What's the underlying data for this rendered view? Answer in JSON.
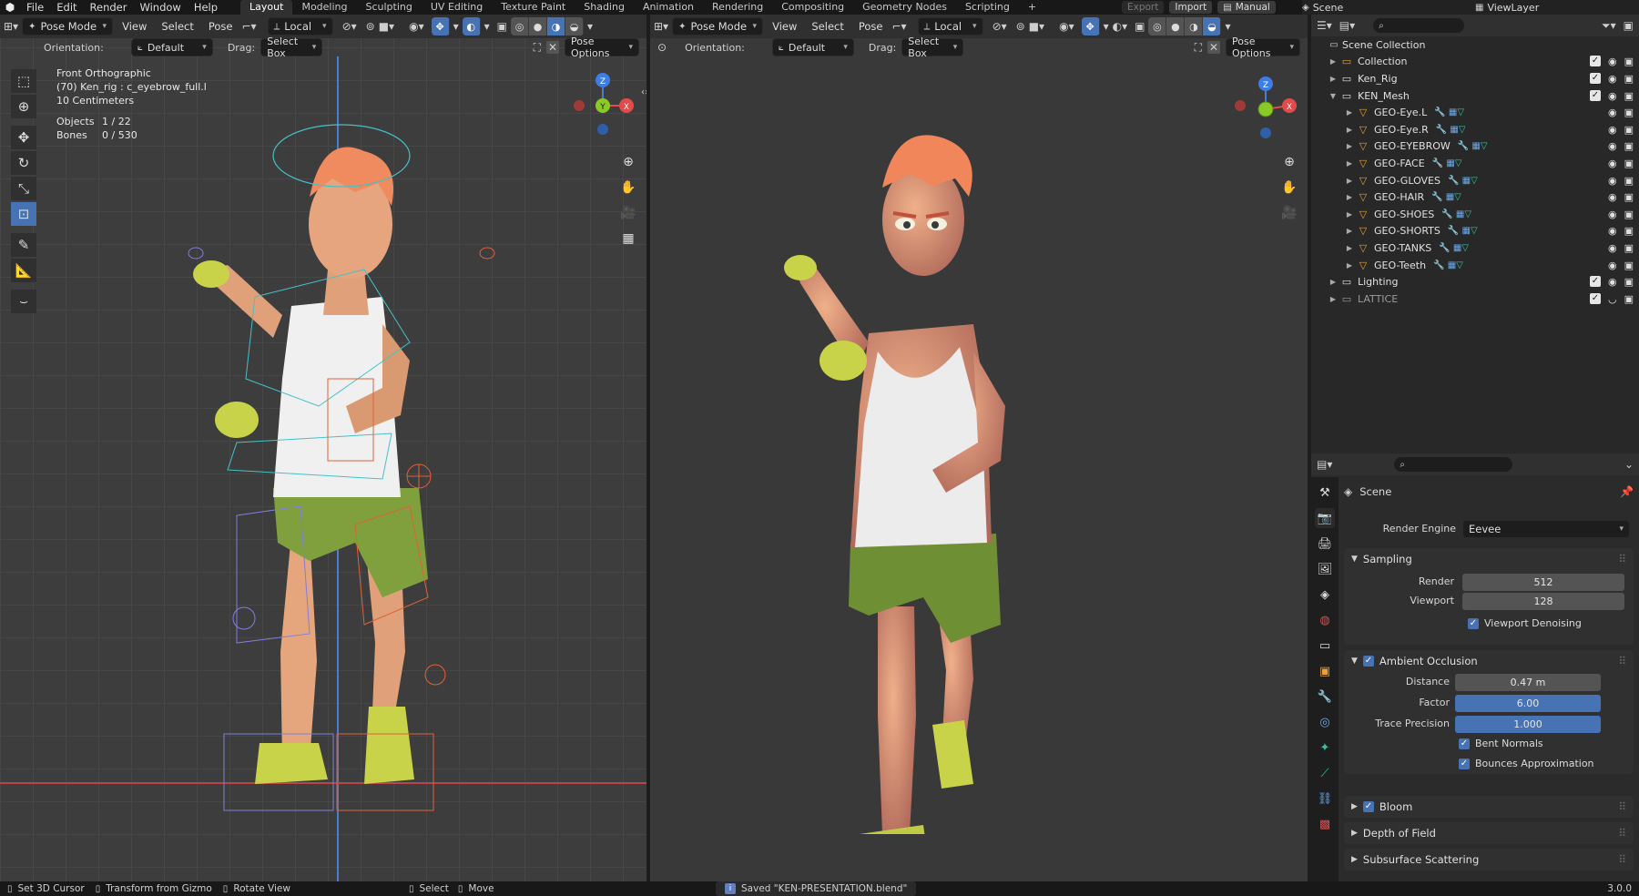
{
  "topbar": {
    "menus": [
      "File",
      "Edit",
      "Render",
      "Window",
      "Help"
    ],
    "workspaces": [
      {
        "label": "Layout",
        "active": true
      },
      {
        "label": "Modeling",
        "active": false
      },
      {
        "label": "Sculpting",
        "active": false
      },
      {
        "label": "UV Editing",
        "active": false
      },
      {
        "label": "Texture Paint",
        "active": false
      },
      {
        "label": "Shading",
        "active": false
      },
      {
        "label": "Animation",
        "active": false
      },
      {
        "label": "Rendering",
        "active": false
      },
      {
        "label": "Compositing",
        "active": false
      },
      {
        "label": "Geometry Nodes",
        "active": false
      },
      {
        "label": "Scripting",
        "active": false
      }
    ],
    "add_tab": "+",
    "export_label": "Export",
    "import_label": "Import",
    "manual_label": "Manual",
    "scene_label": "Scene",
    "viewlayer_label": "ViewLayer"
  },
  "left_viewport": {
    "mode": "Pose Mode",
    "menus": [
      "View",
      "Select",
      "Pose"
    ],
    "transform_orientation": "Local",
    "orientation_label": "Orientation:",
    "orientation_value": "Default",
    "drag_label": "Drag:",
    "drag_value": "Select Box",
    "pose_options": "Pose Options",
    "overlay": {
      "view_name": "Front Orthographic",
      "active": "(70) Ken_rig : c_eyebrow_full.l",
      "scale": "10 Centimeters",
      "objects_label": "Objects",
      "objects_value": "1 / 22",
      "bones_label": "Bones",
      "bones_value": "0 / 530"
    },
    "gizmo": {
      "z": "Z",
      "y": "Y",
      "x": "X"
    }
  },
  "right_viewport": {
    "mode": "Pose Mode",
    "menus": [
      "View",
      "Select",
      "Pose"
    ],
    "transform_orientation": "Local",
    "orientation_label": "Orientation:",
    "orientation_value": "Default",
    "drag_label": "Drag:",
    "drag_value": "Select Box",
    "pose_options": "Pose Options",
    "gizmo": {
      "z": "Z",
      "x": "X"
    }
  },
  "outliner": {
    "root": "Scene Collection",
    "items": [
      {
        "label": "Collection",
        "depth": 1,
        "expanded": false,
        "icon_color": "#e8a03c",
        "muted": false
      },
      {
        "label": "Ken_Rig",
        "depth": 1,
        "expanded": false,
        "icon_color": "#e0e0e0",
        "muted": false
      },
      {
        "label": "KEN_Mesh",
        "depth": 1,
        "expanded": true,
        "icon_color": "#e0e0e0",
        "muted": false
      },
      {
        "label": "GEO-Eye.L",
        "depth": 2,
        "expanded": false,
        "icon_color": "#e8a03c",
        "muted": false
      },
      {
        "label": "GEO-Eye.R",
        "depth": 2,
        "expanded": false,
        "icon_color": "#e8a03c",
        "muted": false
      },
      {
        "label": "GEO-EYEBROW",
        "depth": 2,
        "expanded": false,
        "icon_color": "#e8a03c",
        "muted": false
      },
      {
        "label": "GEO-FACE",
        "depth": 2,
        "expanded": false,
        "icon_color": "#e8a03c",
        "muted": false
      },
      {
        "label": "GEO-GLOVES",
        "depth": 2,
        "expanded": false,
        "icon_color": "#e8a03c",
        "muted": false
      },
      {
        "label": "GEO-HAIR",
        "depth": 2,
        "expanded": false,
        "icon_color": "#e8a03c",
        "muted": false
      },
      {
        "label": "GEO-SHOES",
        "depth": 2,
        "expanded": false,
        "icon_color": "#e8a03c",
        "muted": false
      },
      {
        "label": "GEO-SHORTS",
        "depth": 2,
        "expanded": false,
        "icon_color": "#e8a03c",
        "muted": false
      },
      {
        "label": "GEO-TANKS",
        "depth": 2,
        "expanded": false,
        "icon_color": "#e8a03c",
        "muted": false
      },
      {
        "label": "GEO-Teeth",
        "depth": 2,
        "expanded": false,
        "icon_color": "#e8a03c",
        "muted": false
      },
      {
        "label": "Lighting",
        "depth": 1,
        "expanded": false,
        "icon_color": "#e0e0e0",
        "muted": false
      },
      {
        "label": "LATTICE",
        "depth": 1,
        "expanded": false,
        "icon_color": "#9a9a9a",
        "muted": true
      }
    ]
  },
  "properties": {
    "context_title": "Scene",
    "render_engine_label": "Render Engine",
    "render_engine_value": "Eevee",
    "sampling": {
      "title": "Sampling",
      "render_label": "Render",
      "render_value": "512",
      "viewport_label": "Viewport",
      "viewport_value": "128",
      "denoise_label": "Viewport Denoising"
    },
    "ao": {
      "title": "Ambient Occlusion",
      "distance_label": "Distance",
      "distance_value": "0.47 m",
      "factor_label": "Factor",
      "factor_value": "6.00",
      "trace_label": "Trace Precision",
      "trace_value": "1.000",
      "bent_label": "Bent Normals",
      "bounces_label": "Bounces Approximation"
    },
    "bloom": "Bloom",
    "dof": "Depth of Field",
    "sss": "Subsurface Scattering"
  },
  "status": {
    "items": [
      "Set 3D Cursor",
      "Transform from Gizmo",
      "Rotate View"
    ],
    "select": "Select",
    "move": "Move",
    "saved_message": "Saved \"KEN-PRESENTATION.blend\"",
    "version": "3.0.0"
  },
  "colors": {
    "accent": "#4772b3",
    "header": "#303030",
    "viewport": "#3d3d3d",
    "object_orange": "#e8a03c",
    "gizmo_x": "#e34a4a",
    "gizmo_y": "#8ac926",
    "gizmo_z": "#3d7de4"
  }
}
